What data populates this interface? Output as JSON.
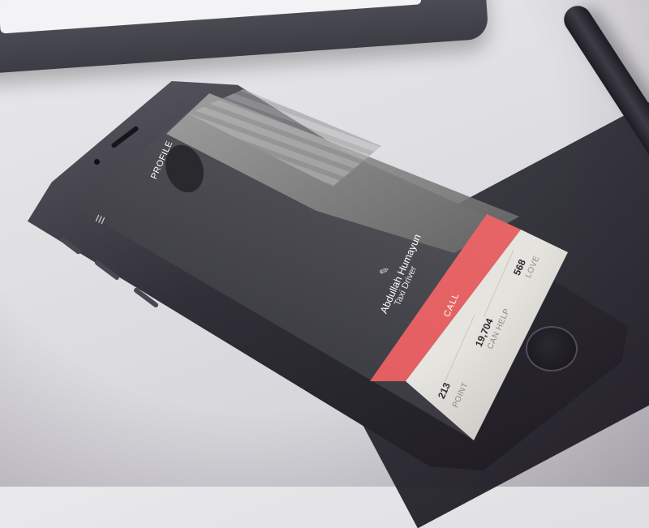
{
  "screen": {
    "title": "PROFILE",
    "menu_icon": "hamburger-menu-icon",
    "edit_icon": "edit-icon"
  },
  "profile": {
    "name": "Abdullah Humayun",
    "role": "Taxi Driver"
  },
  "actions": {
    "call_label": "CALL"
  },
  "stats": [
    {
      "value": "213",
      "label": "POINT"
    },
    {
      "value": "19,704",
      "label": "CAN HELP"
    },
    {
      "value": "568",
      "label": "LOVE"
    }
  ],
  "colors": {
    "call": "#e35f61",
    "stats_bg": "#eeede9",
    "text_light": "#ffffff",
    "stat_value": "#2a2a30",
    "stat_label": "#8e8d88"
  }
}
